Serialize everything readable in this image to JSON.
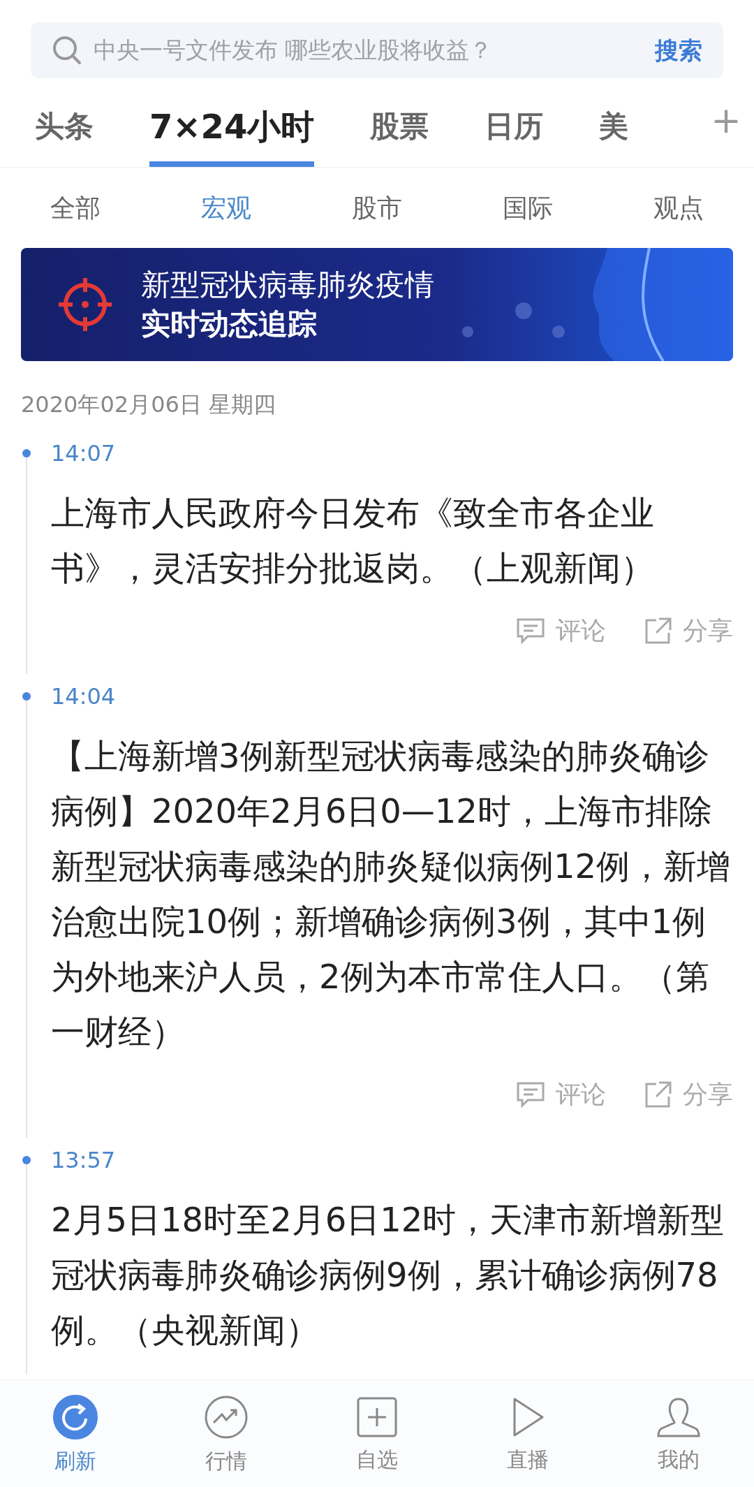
{
  "search": {
    "placeholder": "中央一号文件发布 哪些农业股将收益？",
    "button": "搜索"
  },
  "tabs": [
    {
      "label": "头条",
      "selected": false
    },
    {
      "label": "7×24小时",
      "selected": true
    },
    {
      "label": "股票",
      "selected": false
    },
    {
      "label": "日历",
      "selected": false
    },
    {
      "label": "美",
      "selected": false
    }
  ],
  "add_tab": "+",
  "subtabs": [
    {
      "label": "全部",
      "selected": false
    },
    {
      "label": "宏观",
      "selected": true
    },
    {
      "label": "股市",
      "selected": false
    },
    {
      "label": "国际",
      "selected": false
    },
    {
      "label": "观点",
      "selected": false
    }
  ],
  "banner": {
    "title": "新型冠状病毒肺炎疫情",
    "subtitle": "实时动态追踪"
  },
  "date": "2020年02月06日 星期四",
  "news": [
    {
      "time": "14:07",
      "text": "上海市人民政府今日发布《致全市各企业书》，灵活安排分批返岗。（上观新闻）",
      "actions": [
        "评论",
        "分享"
      ]
    },
    {
      "time": "14:04",
      "text": "【上海新增3例新型冠状病毒感染的肺炎确诊病例】2020年2月6日0—12时，上海市排除新型冠状病毒感染的肺炎疑似病例12例，新增治愈出院10例；新增确诊病例3例，其中1例为外地来沪人员，2例为本市常住人口。（第一财经）",
      "actions": [
        "评论",
        "分享"
      ]
    },
    {
      "time": "13:57",
      "text": "2月5日18时至2月6日12时，天津市新增新型冠状病毒肺炎确诊病例9例，累计确诊病例78例。（央视新闻）"
    }
  ],
  "nav": [
    {
      "label": "刷新",
      "selected": true
    },
    {
      "label": "行情",
      "selected": false
    },
    {
      "label": "自选",
      "selected": false
    },
    {
      "label": "直播",
      "selected": false
    },
    {
      "label": "我的",
      "selected": false
    }
  ]
}
